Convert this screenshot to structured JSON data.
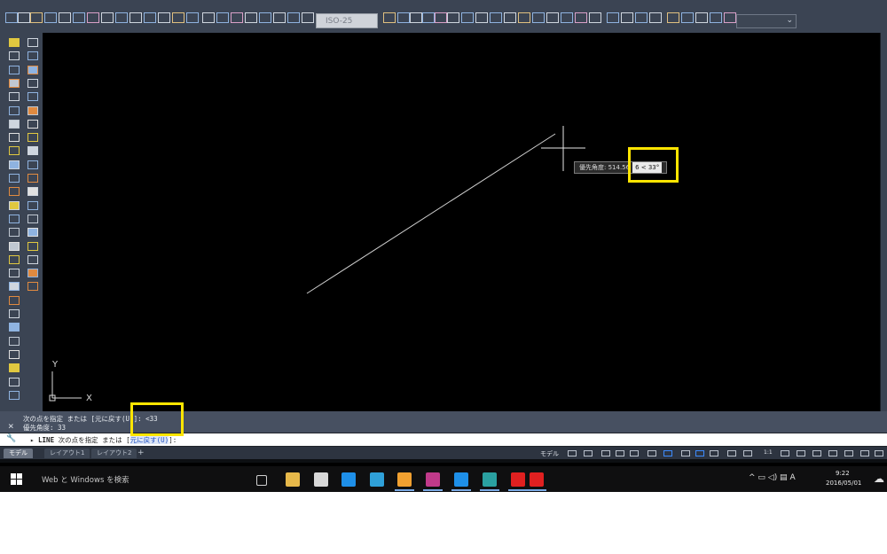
{
  "toolbar": {
    "dim_style_value": "ISO-25"
  },
  "canvas": {
    "ucs_x_label": "X",
    "ucs_y_label": "Y",
    "tooltip": {
      "prefix": "優先角度: 514.56",
      "input": "6 < 33°"
    }
  },
  "command_line": {
    "history": [
      "次の点を指定 または [元に戻す(U)]: <33",
      "優先角度: 33"
    ],
    "prompt_command": "LINE",
    "prompt_text": "次の点を指定 または [",
    "prompt_option": "元に戻す(U)",
    "prompt_suffix": "]:",
    "close_glyph": "×"
  },
  "layout_tabs": [
    {
      "label": "モデル",
      "active": true
    },
    {
      "label": "レイアウト1",
      "active": false
    },
    {
      "label": "レイアウト2",
      "active": false
    }
  ],
  "layout_add": "+",
  "status_bar": {
    "model_label": "モデル",
    "scale": "1:1"
  },
  "taskbar": {
    "search_placeholder": "Web と Windows を検索",
    "time": "9:22",
    "date": "2016/05/01",
    "ime": "A",
    "autocad_letter": "A"
  },
  "colors": {
    "highlight": "#ffe500",
    "ui_dark": "#3b4453",
    "canvas": "#000000"
  }
}
